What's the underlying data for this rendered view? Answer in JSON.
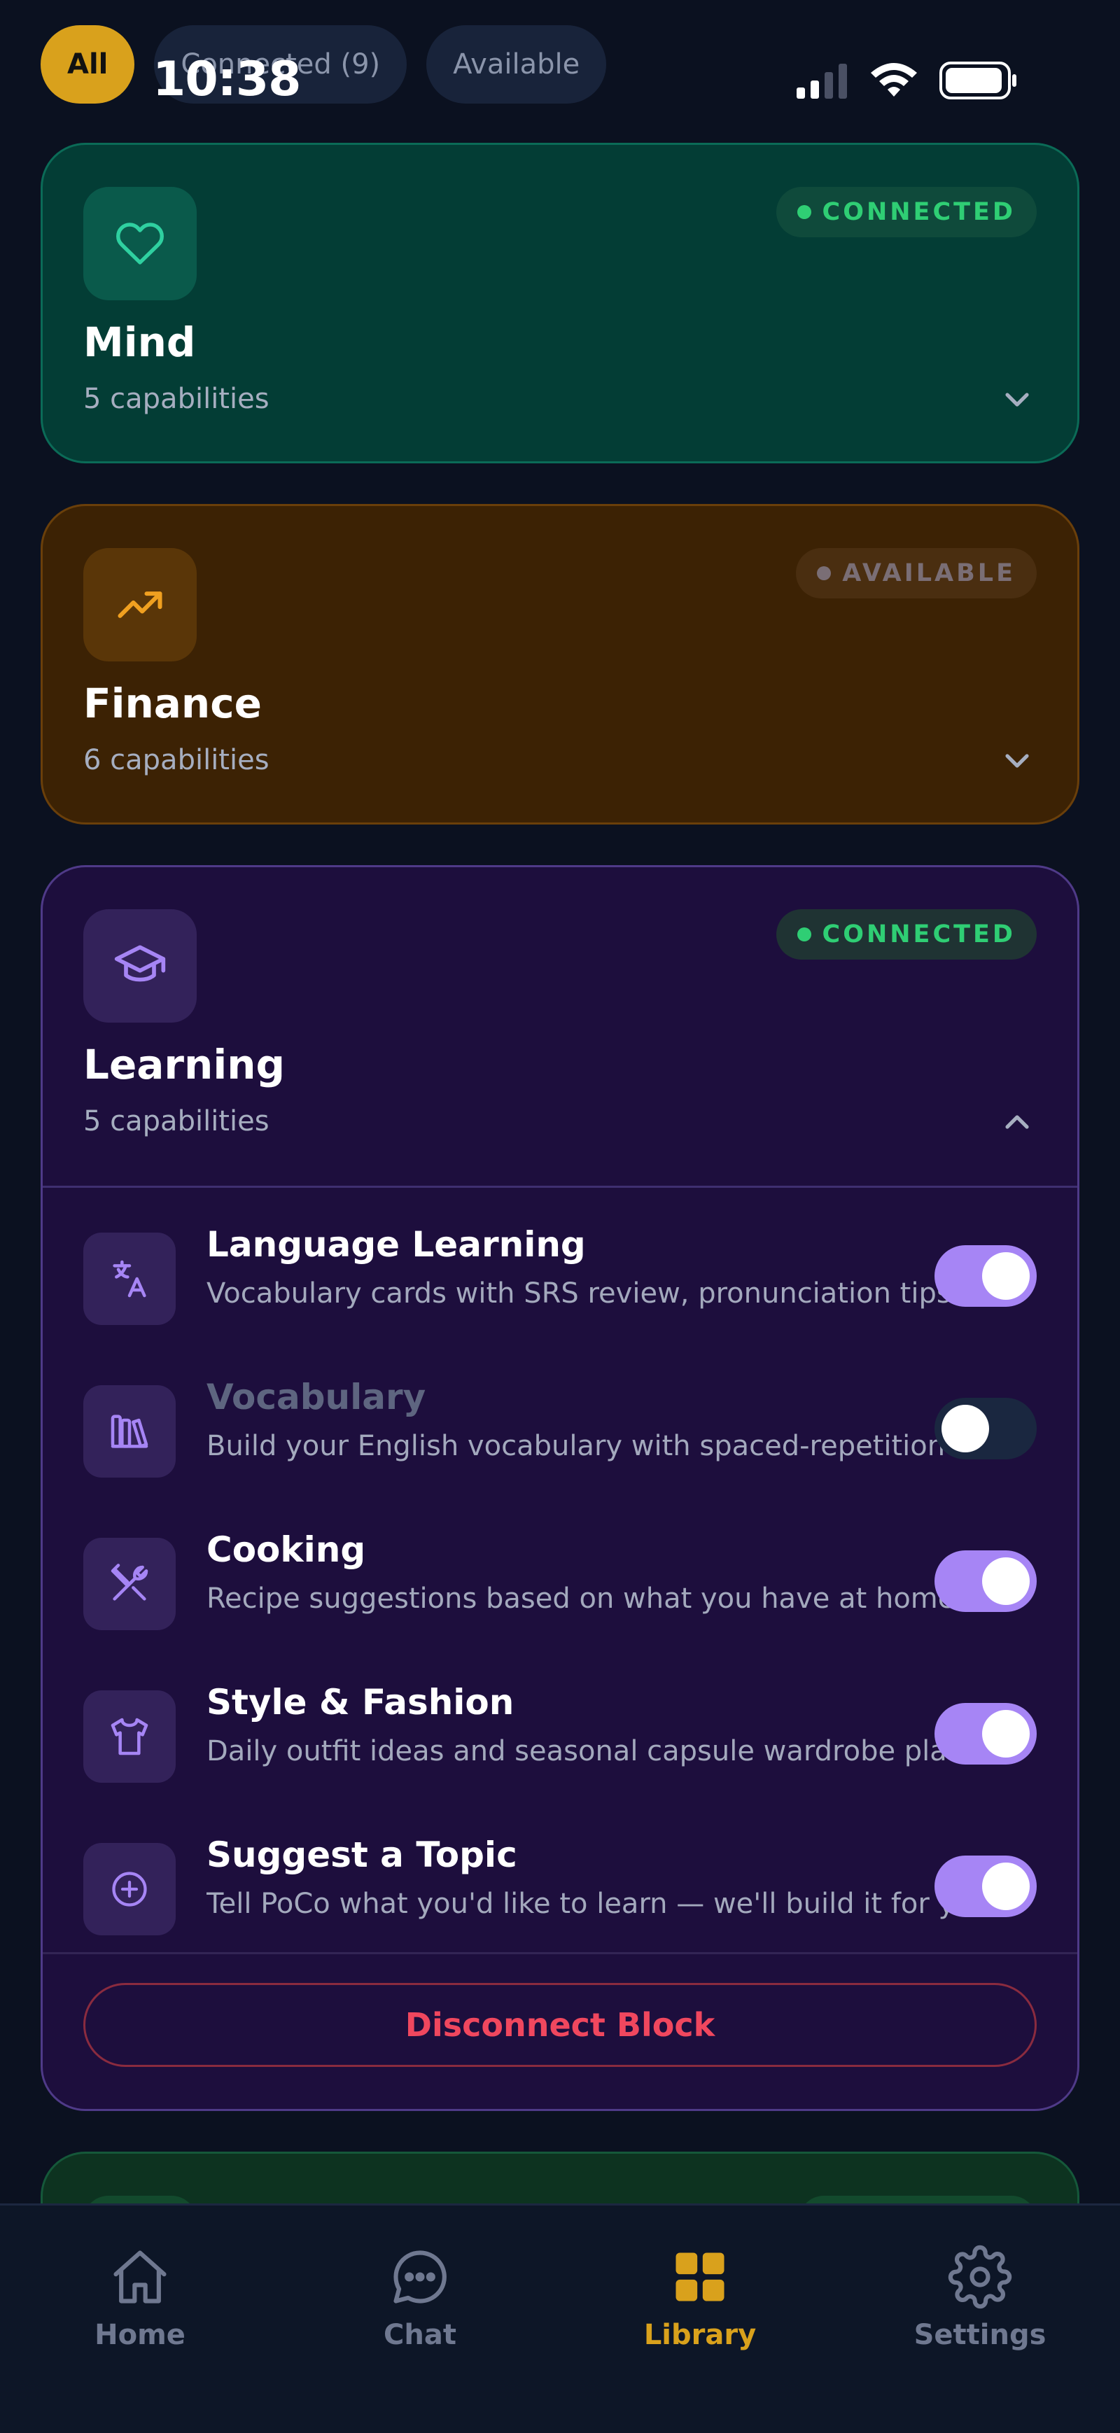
{
  "status_bar": {
    "time": "10:38"
  },
  "filters": [
    {
      "label": "All",
      "active": true
    },
    {
      "label": "Connected (9)",
      "active": false
    },
    {
      "label": "Available",
      "active": false
    }
  ],
  "cards": {
    "mind": {
      "title": "Mind",
      "subtitle": "5 capabilities",
      "status": "CONNECTED",
      "icon": "heart-icon",
      "color": "#033d35"
    },
    "finance": {
      "title": "Finance",
      "subtitle": "6 capabilities",
      "status": "AVAILABLE",
      "icon": "trending-up-icon",
      "color": "#3c2204"
    },
    "learning": {
      "title": "Learning",
      "subtitle": "5 capabilities",
      "status": "CONNECTED",
      "icon": "graduation-cap-icon",
      "color": "#1d0e3d",
      "capabilities": [
        {
          "title": "Language Learning",
          "description": "Vocabulary cards with SRS review, pronunciation tips and more",
          "icon": "translate-icon",
          "enabled": true
        },
        {
          "title": "Vocabulary",
          "description": "Build your English vocabulary with spaced-repetition practice",
          "icon": "library-books-icon",
          "enabled": false
        },
        {
          "title": "Cooking",
          "description": "Recipe suggestions based on what you have at home",
          "icon": "utensils-icon",
          "enabled": true
        },
        {
          "title": "Style & Fashion",
          "description": "Daily outfit ideas and seasonal capsule wardrobe planning",
          "icon": "shirt-icon",
          "enabled": true
        },
        {
          "title": "Suggest a Topic",
          "description": "Tell PoCo what you'd like to learn — we'll build it for you",
          "icon": "plus-circle-icon",
          "enabled": true
        }
      ],
      "disconnect_label": "Disconnect Block"
    }
  },
  "bottom_nav": [
    {
      "label": "Home",
      "icon": "home-icon",
      "active": false
    },
    {
      "label": "Chat",
      "icon": "chat-bubble-icon",
      "active": false
    },
    {
      "label": "Library",
      "icon": "grid-icon",
      "active": true
    },
    {
      "label": "Settings",
      "icon": "gear-icon",
      "active": false
    }
  ],
  "colors": {
    "accent": "#d9a11c",
    "connected": "#2fce74",
    "toggle_on": "#a685f5",
    "danger": "#f0475e"
  }
}
